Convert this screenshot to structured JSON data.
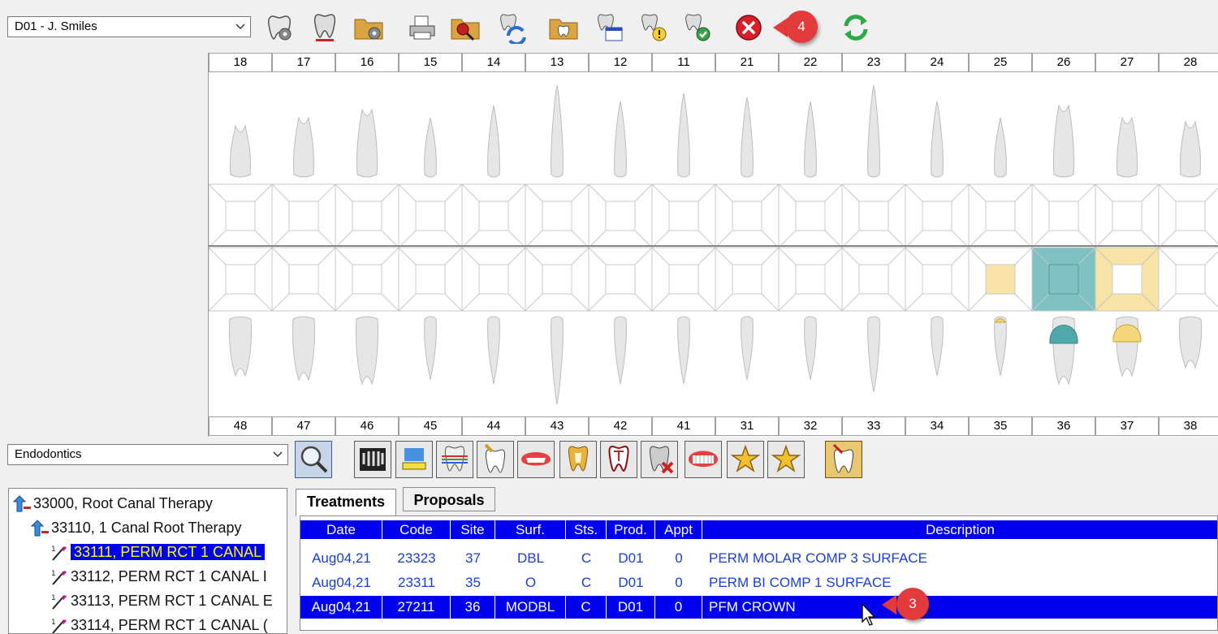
{
  "provider_select": {
    "value": "D01 - J. Smiles"
  },
  "toolbar": {
    "icons": [
      "tooth-settings-icon",
      "tooth-x-ray-icon",
      "folder-settings-icon",
      "printer-icon",
      "folder-search-icon",
      "tooth-refresh-icon",
      "folder-tooth-icon",
      "tooth-calendar-icon",
      "tooth-warning-icon",
      "tooth-check-icon",
      "close-icon",
      "refresh-icon"
    ],
    "callout_4": "4"
  },
  "chart": {
    "upper_numbers": [
      "18",
      "17",
      "16",
      "15",
      "14",
      "13",
      "12",
      "11",
      "21",
      "22",
      "23",
      "24",
      "25",
      "26",
      "27",
      "28"
    ],
    "lower_numbers": [
      "48",
      "47",
      "46",
      "45",
      "44",
      "43",
      "42",
      "41",
      "31",
      "32",
      "33",
      "34",
      "35",
      "36",
      "37",
      "38"
    ],
    "colors": {
      "composite": "#f8e4a6",
      "crown": "#7ec2c4",
      "crown_dark": "#4fa8ab"
    }
  },
  "category_select": {
    "value": "Endodontics"
  },
  "proc_toolbar": {
    "icons": [
      "search-icon",
      "x-ray-film-icon",
      "tooth-brush-icon",
      "tooth-ortho-icon",
      "tooth-implant-icon",
      "denture-icon",
      "gold-tooth-icon",
      "tooth-extract-icon",
      "tooth-missing-icon",
      "full-denture-icon",
      "star-icon",
      "star-icon",
      "tooth-note-icon"
    ]
  },
  "tree": {
    "items": [
      {
        "label": "33000, Root Canal Therapy",
        "level": 0
      },
      {
        "label": "33110, 1 Canal Root Therapy",
        "level": 1
      },
      {
        "label": "33111, PERM RCT 1 CANAL",
        "level": 2,
        "selected": true
      },
      {
        "label": "33112, PERM RCT 1 CANAL I",
        "level": 2
      },
      {
        "label": "33113, PERM RCT 1 CANAL E",
        "level": 2
      },
      {
        "label": "33114, PERM RCT 1 CANAL (",
        "level": 2
      }
    ]
  },
  "tabs": [
    {
      "label": "Treatments",
      "active": true
    },
    {
      "label": "Proposals",
      "active": false
    }
  ],
  "grid": {
    "columns": [
      "Date",
      "Code",
      "Site",
      "Surf.",
      "Sts.",
      "Prod.",
      "Appt",
      "Description"
    ],
    "rows": [
      [
        "Aug04,21",
        "23323",
        "37",
        "DBL",
        "C",
        "D01",
        "0",
        "PERM MOLAR COMP 3 SURFACE"
      ],
      [
        "Aug04,21",
        "23311",
        "35",
        "O",
        "C",
        "D01",
        "0",
        "PERM BI COMP 1 SURFACE"
      ],
      [
        "Aug04,21",
        "27211",
        "36",
        "MODBL",
        "C",
        "D01",
        "0",
        "PFM CROWN"
      ]
    ],
    "selected_row": 2,
    "callout_3": "3"
  }
}
